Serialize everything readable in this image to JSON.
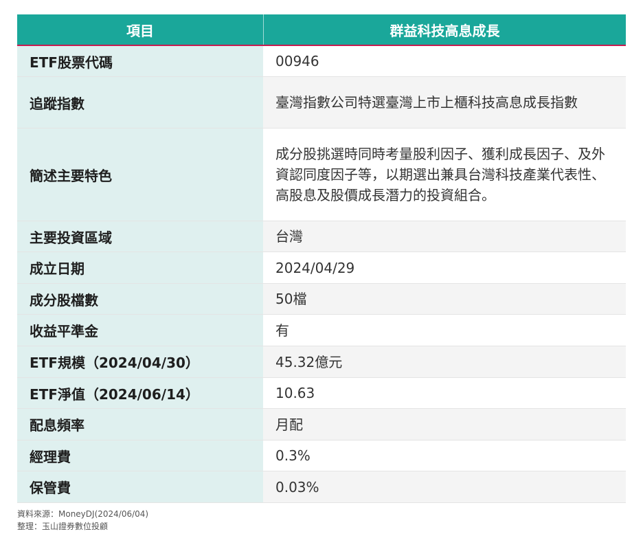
{
  "header": {
    "col1": "項目",
    "col2": "群益科技高息成長"
  },
  "rows": [
    {
      "key": "ETF股票代碼",
      "value": "00946"
    },
    {
      "key": "追蹤指數",
      "value": "臺灣指數公司特選臺灣上市上櫃科技高息成長指數"
    },
    {
      "key": "簡述主要特色",
      "value": "成分股挑選時同時考量股利因子、獲利成長因子、及外資認同度因子等，以期選出兼具台灣科技產業代表性、高股息及股價成長潛力的投資組合。"
    },
    {
      "key": "主要投資區域",
      "value": "台灣"
    },
    {
      "key": "成立日期",
      "value": "2024/04/29"
    },
    {
      "key": "成分股檔數",
      "value": "50檔"
    },
    {
      "key": "收益平準金",
      "value": "有"
    },
    {
      "key": "ETF規模（2024/04/30）",
      "value": "45.32億元"
    },
    {
      "key": "ETF淨值（2024/06/14）",
      "value": "10.63"
    },
    {
      "key": "配息頻率",
      "value": "月配"
    },
    {
      "key": "經理費",
      "value": "0.3%"
    },
    {
      "key": "保管費",
      "value": "0.03%"
    }
  ],
  "footer": {
    "source": "資料來源：MoneyDJ(2024/06/04)",
    "compiled": "整理：玉山證券數位投顧"
  },
  "colors": {
    "header_bg": "#1aa79a",
    "header_border": "#c61c4f",
    "key_bg": "#dff0ef"
  }
}
